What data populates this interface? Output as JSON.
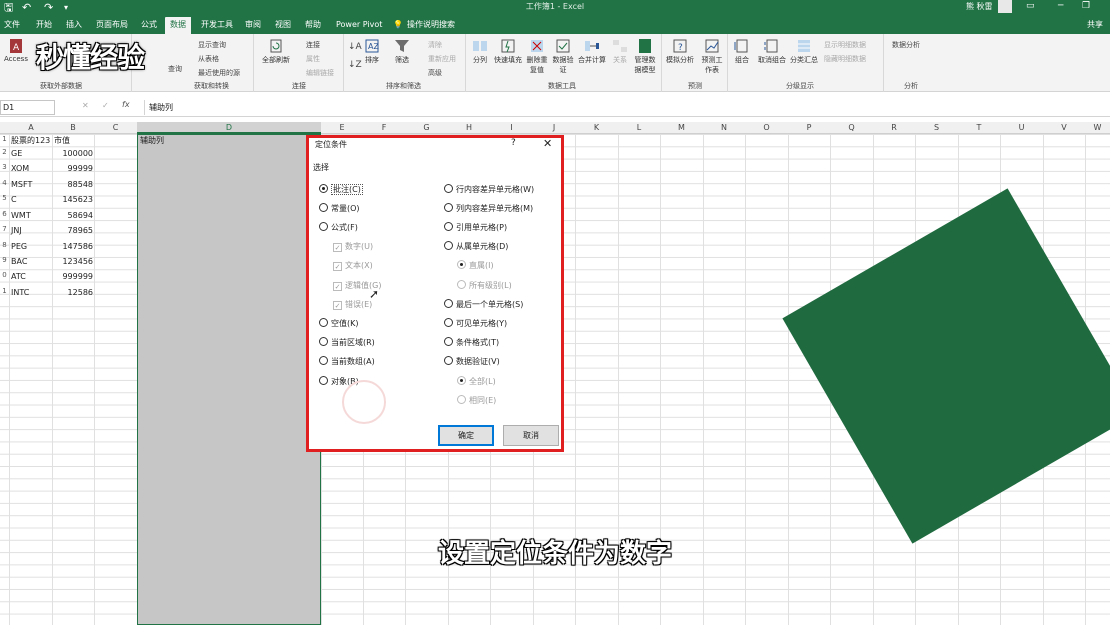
{
  "titlebar": {
    "title": "工作簿1 - Excel",
    "user": "熊 秋雷"
  },
  "tabs": [
    "文件",
    "开始",
    "插入",
    "页面布局",
    "公式",
    "数据",
    "开发工具",
    "审阅",
    "视图",
    "帮助",
    "Power Pivot",
    "操作说明搜索",
    "共享"
  ],
  "ribbon": {
    "get_external": {
      "label": "获取外部数据",
      "access": "Access"
    },
    "get_transform": {
      "label": "获取和转换",
      "query": "查询",
      "show_query": "显示查询",
      "from_table": "从表格",
      "recent_sources": "最近使用的源"
    },
    "connections": {
      "label": "连接",
      "refresh_all": "全部刷新",
      "conn": "连接",
      "properties": "属性",
      "edit_links": "编辑链接"
    },
    "sort_filter": {
      "label": "排序和筛选",
      "sort": "排序",
      "filter": "筛选",
      "clear": "清除",
      "reapply": "重新应用",
      "advanced": "高级"
    },
    "data_tools": {
      "label": "数据工具",
      "split": "分列",
      "flash_fill": "快速填充",
      "remove_dup": "删除重复值",
      "validate": "数据验证",
      "consolidate": "合并计算",
      "relations": "关系",
      "manage_model": "管理数据模型"
    },
    "forecast": {
      "label": "预测",
      "what_if": "模拟分析",
      "forecast_sheet": "预测工作表"
    },
    "outline": {
      "label": "分级显示",
      "group": "组合",
      "ungroup": "取消组合",
      "subtotal": "分类汇总",
      "show_detail": "显示明细数据",
      "hide_detail": "隐藏明细数据"
    },
    "analysis": {
      "label": "分析",
      "data_analysis": "数据分析"
    }
  },
  "watermark": "秒懂经验",
  "formula_bar": {
    "name_box": "D1",
    "formula": "辅助列"
  },
  "columns": [
    "A",
    "B",
    "C",
    "D",
    "E",
    "F",
    "G",
    "H",
    "I",
    "J",
    "K",
    "L",
    "M",
    "N",
    "O",
    "P",
    "Q",
    "R",
    "S",
    "T",
    "U",
    "V",
    "W"
  ],
  "rows": [
    {
      "n": "1",
      "a": "股票的123",
      "b": "市值"
    },
    {
      "n": "2",
      "a": "GE",
      "b": "100000"
    },
    {
      "n": "3",
      "a": "XOM",
      "b": "99999"
    },
    {
      "n": "4",
      "a": "MSFT",
      "b": "88548"
    },
    {
      "n": "5",
      "a": "C",
      "b": "145623"
    },
    {
      "n": "6",
      "a": "WMT",
      "b": "58694"
    },
    {
      "n": "7",
      "a": "JNJ",
      "b": "78965"
    },
    {
      "n": "8",
      "a": "PEG",
      "b": "147586"
    },
    {
      "n": "9",
      "a": "BAC",
      "b": "123456"
    },
    {
      "n": "0",
      "a": "ATC",
      "b": "999999"
    },
    {
      "n": "1",
      "a": "INTC",
      "b": "12586"
    }
  ],
  "d1": "辅助列",
  "dialog": {
    "title": "定位条件",
    "help": "?",
    "close": "✕",
    "section": "选择",
    "left_options": [
      "批注(C)",
      "常量(O)",
      "公式(F)",
      "数字(U)",
      "文本(X)",
      "逻辑值(G)",
      "错误(E)",
      "空值(K)",
      "当前区域(R)",
      "当前数组(A)",
      "对象(B)"
    ],
    "right_options": [
      "行内容差异单元格(W)",
      "列内容差异单元格(M)",
      "引用单元格(P)",
      "从属单元格(D)",
      "直属(I)",
      "所有级别(L)",
      "最后一个单元格(S)",
      "可见单元格(Y)",
      "条件格式(T)",
      "数据验证(V)",
      "全部(L)",
      "相同(E)"
    ],
    "ok": "确定",
    "cancel": "取消"
  },
  "caption": "设置定位条件为数字"
}
